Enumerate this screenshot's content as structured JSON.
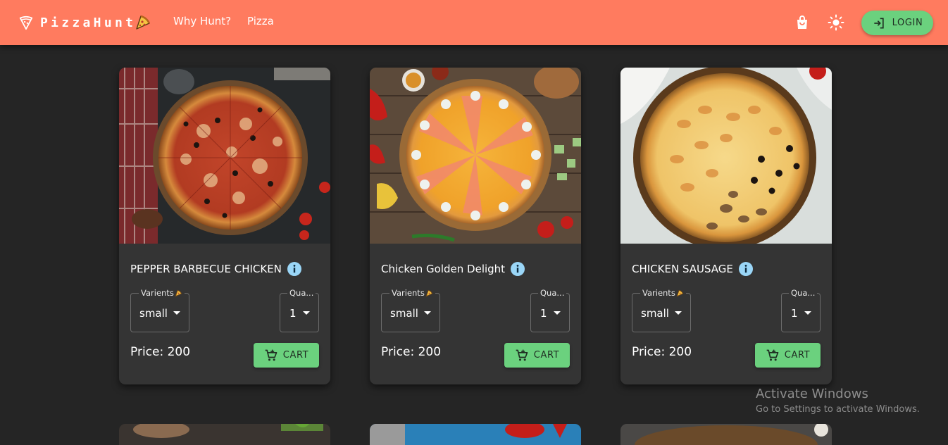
{
  "header": {
    "brand": "PizzaHunt",
    "nav": [
      "Why Hunt?",
      "Pizza"
    ],
    "login_label": "LOGIN",
    "colors": {
      "bar": "#ff7b5f",
      "accent_button": "#6bd17e"
    }
  },
  "products": [
    {
      "name": "PEPPER BARBECUE CHICKEN",
      "variants_label": "Varients",
      "variant_value": "small",
      "quantity_label": "Quantity",
      "quantity_label_display": "Qua...",
      "quantity_value": "1",
      "price_text": "Price: 200",
      "cart_label": "CART"
    },
    {
      "name": "Chicken Golden Delight",
      "variants_label": "Varients",
      "variant_value": "small",
      "quantity_label": "Quantity",
      "quantity_label_display": "Qua...",
      "quantity_value": "1",
      "price_text": "Price: 200",
      "cart_label": "CART"
    },
    {
      "name": "CHICKEN SAUSAGE",
      "variants_label": "Varients",
      "variant_value": "small",
      "quantity_label": "Quantity",
      "quantity_label_display": "Qua...",
      "quantity_value": "1",
      "price_text": "Price: 200",
      "cart_label": "CART"
    }
  ],
  "watermark": {
    "title": "Activate Windows",
    "subtitle": "Go to Settings to activate Windows."
  },
  "icons": [
    "pizza-logo-icon",
    "pizza-slice-icon",
    "shopping-bag-icon",
    "sun-icon",
    "login-icon",
    "info-icon",
    "add-cart-icon"
  ]
}
